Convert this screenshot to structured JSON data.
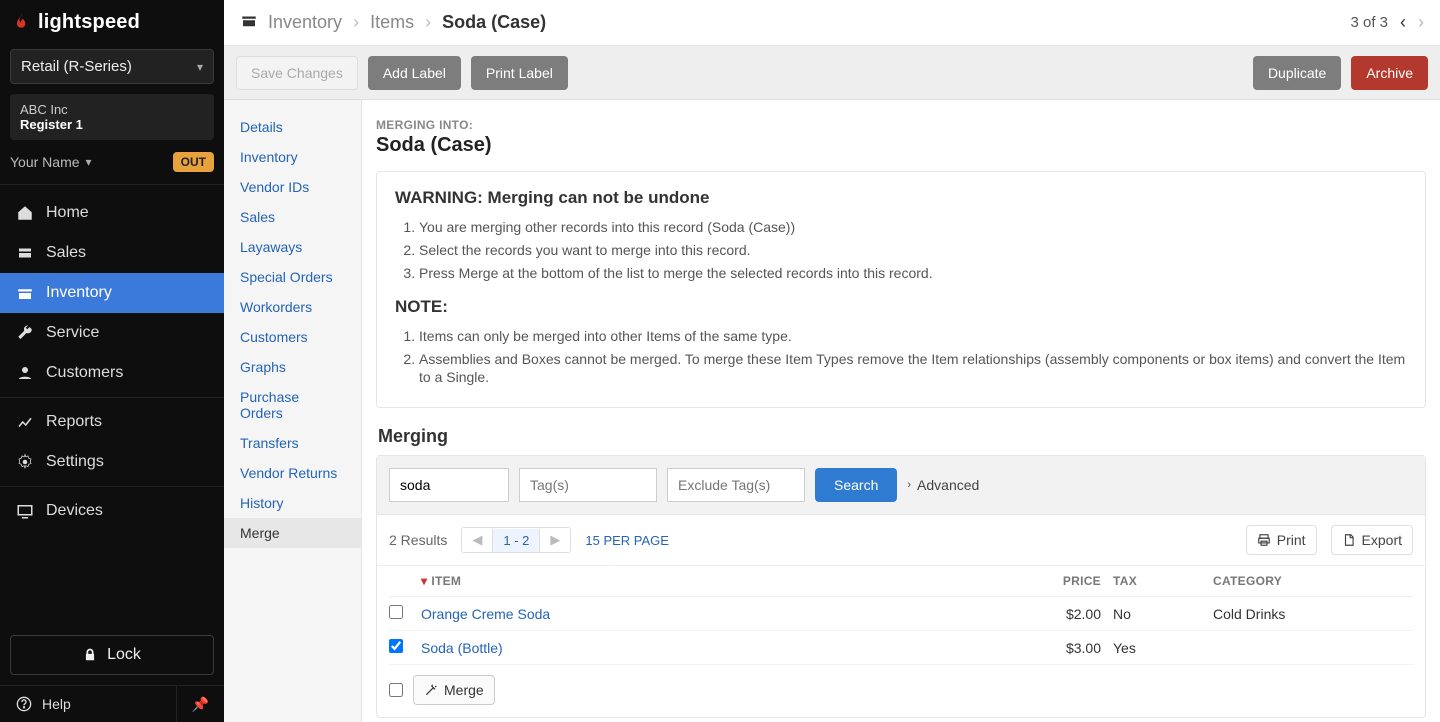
{
  "brand": {
    "name": "lightspeed"
  },
  "product_selector": {
    "label": "Retail (R-Series)"
  },
  "shop": {
    "name": "ABC Inc",
    "register": "Register 1"
  },
  "user": {
    "name": "Your Name",
    "out_label": "OUT"
  },
  "nav": {
    "home": "Home",
    "sales": "Sales",
    "inventory": "Inventory",
    "service": "Service",
    "customers": "Customers",
    "reports": "Reports",
    "settings": "Settings",
    "devices": "Devices",
    "lock": "Lock",
    "help": "Help"
  },
  "breadcrumb": {
    "section": "Inventory",
    "sub": "Items",
    "page": "Soda (Case)"
  },
  "top_pager": {
    "label": "3 of 3"
  },
  "actions": {
    "save": "Save Changes",
    "add_label": "Add Label",
    "print_label": "Print Label",
    "duplicate": "Duplicate",
    "archive": "Archive"
  },
  "subnav": {
    "details": "Details",
    "inventory": "Inventory",
    "vendor_ids": "Vendor IDs",
    "sales": "Sales",
    "layaways": "Layaways",
    "special_orders": "Special Orders",
    "workorders": "Workorders",
    "customers": "Customers",
    "graphs": "Graphs",
    "purchase_orders": "Purchase Orders",
    "transfers": "Transfers",
    "vendor_returns": "Vendor Returns",
    "history": "History",
    "merge": "Merge"
  },
  "merge_header": {
    "label": "MERGING INTO:",
    "title": "Soda (Case)"
  },
  "warning": {
    "title": "WARNING: Merging can not be undone",
    "items": [
      "You are merging other records into this record (Soda (Case))",
      "Select the records you want to merge into this record.",
      "Press Merge at the bottom of the list to merge the selected records into this record."
    ],
    "note_title": "NOTE:",
    "notes": [
      "Items can only be merged into other Items of the same type.",
      "Assemblies and Boxes cannot be merged. To merge these Item Types remove the Item relationships (assembly components or box items) and convert the Item to a Single."
    ]
  },
  "merging_section_title": "Merging",
  "search": {
    "query": "soda",
    "tags_placeholder": "Tag(s)",
    "exclude_placeholder": "Exclude Tag(s)",
    "button": "Search",
    "advanced": "Advanced"
  },
  "results": {
    "count_label": "2 Results",
    "page_label": "1 - 2",
    "per_page": "15 PER PAGE",
    "print": "Print",
    "export": "Export"
  },
  "columns": {
    "item": "ITEM",
    "price": "PRICE",
    "tax": "TAX",
    "category": "CATEGORY"
  },
  "rows": [
    {
      "checked": false,
      "item": "Orange Creme Soda",
      "price": "$2.00",
      "tax": "No",
      "category": "Cold Drinks"
    },
    {
      "checked": true,
      "item": "Soda (Bottle)",
      "price": "$3.00",
      "tax": "Yes",
      "category": ""
    }
  ],
  "merge_btn": "Merge"
}
